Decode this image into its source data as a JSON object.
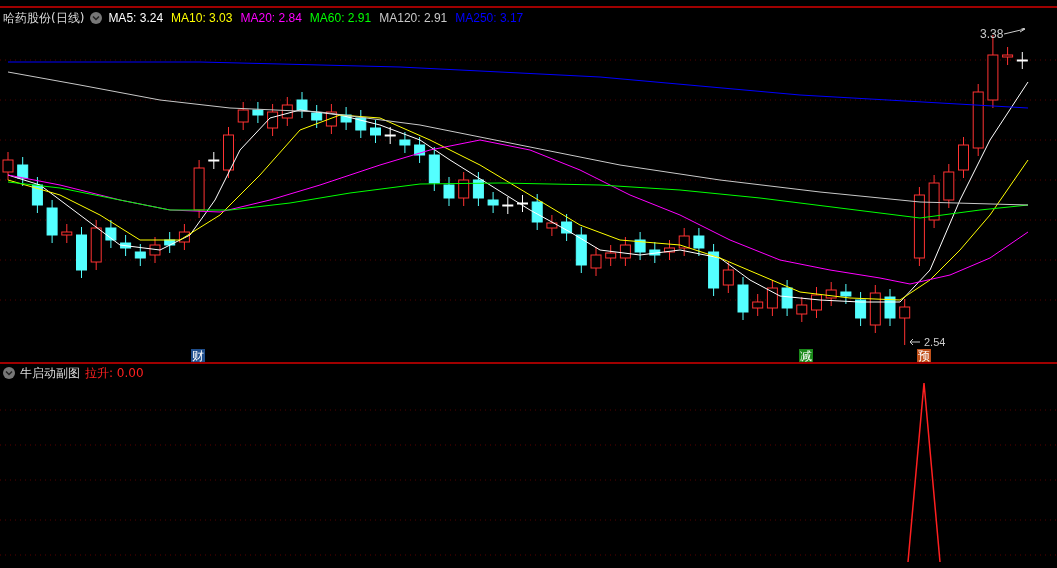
{
  "header": {
    "title": "哈药股份(日线)",
    "ma_legend": [
      {
        "label": "MA5: 3.24",
        "color": "#ffffff"
      },
      {
        "label": "MA10: 3.03",
        "color": "#ffff00"
      },
      {
        "label": "MA20: 2.84",
        "color": "#ff00ff"
      },
      {
        "label": "MA60: 2.91",
        "color": "#00ff00"
      },
      {
        "label": "MA120: 2.91",
        "color": "#c8c8c8"
      },
      {
        "label": "MA250: 3.17",
        "color": "#0000ff"
      }
    ]
  },
  "price_chart": {
    "high_label": "3.38",
    "low_label": "2.54",
    "markers": [
      {
        "text": "财",
        "color": "#1f4e8c"
      },
      {
        "text": "减",
        "color": "#1a8a1a"
      },
      {
        "text": "预",
        "color": "#c0501a"
      }
    ]
  },
  "sub_chart": {
    "title": "牛启动副图",
    "indicator": "拉升: 0.00"
  }
}
